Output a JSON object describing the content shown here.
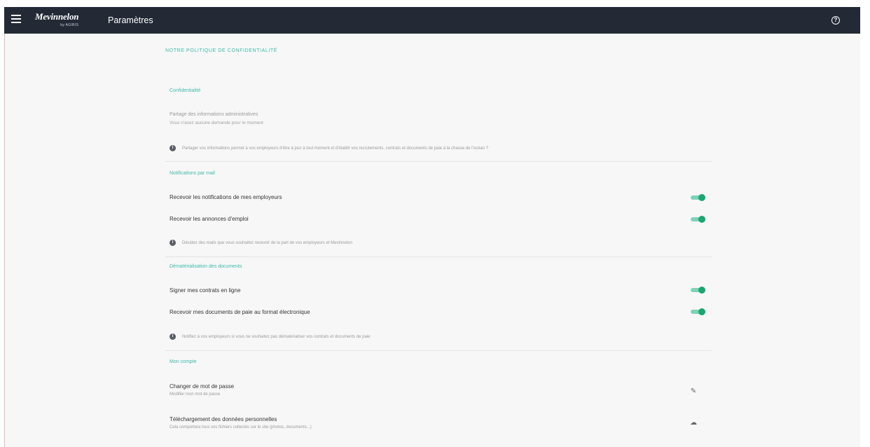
{
  "header": {
    "brand": "Mevinnelon",
    "brand_sub": "by AGIRIS",
    "title": "Paramètres",
    "icons": {
      "menu": "hamburger-icon",
      "help": "help-circle-icon"
    }
  },
  "policy_link": "NOTRE POLITIQUE DE CONFIDENTIALITÉ",
  "confidentiality": {
    "title": "Confidentialité",
    "share_title": "Partage des informations administratives",
    "share_status": "Vous n'avez aucune demande pour le moment",
    "info": "Partager vos informations permet à vos employeurs d'être à jour à tout moment et d'établir vos recrutements, contrats et documents de paie à la chasse de l'océan ?"
  },
  "email_notifications": {
    "title": "Notifications par mail",
    "items": [
      {
        "label": "Recevoir les notifications de mes employeurs",
        "enabled": true
      },
      {
        "label": "Recevoir les annonces d'emploi",
        "enabled": true
      }
    ],
    "info": "Décidez des mails que vous souhaitez recevoir de la part de vos employeurs et Mevinnelon"
  },
  "dematerialization": {
    "title": "Dématérialisation des documents",
    "items": [
      {
        "label": "Signer mes contrats en ligne",
        "enabled": true
      },
      {
        "label": "Recevoir mes documents de paie au format électronique",
        "enabled": true
      }
    ],
    "info": "Notifiez à vos employeurs si vous ne souhaitez pas dématérialiser vos contrats et documents de paie"
  },
  "account": {
    "title": "Mon compte",
    "change_password": {
      "label": "Changer de mot de passe",
      "sub": "Modifier mon mot de passe",
      "icon": "pencil-icon"
    },
    "download_data": {
      "label": "Téléchargement des données personnelles",
      "sub": "Cela comportera tous vos fichiers collectés sur le site (photos, documents...)",
      "icon": "cloud-download-icon"
    }
  },
  "colors": {
    "accent": "#3fbaa7",
    "toggle_on": "#18a870",
    "topbar": "#232a36",
    "background": "#f7f7f8"
  }
}
